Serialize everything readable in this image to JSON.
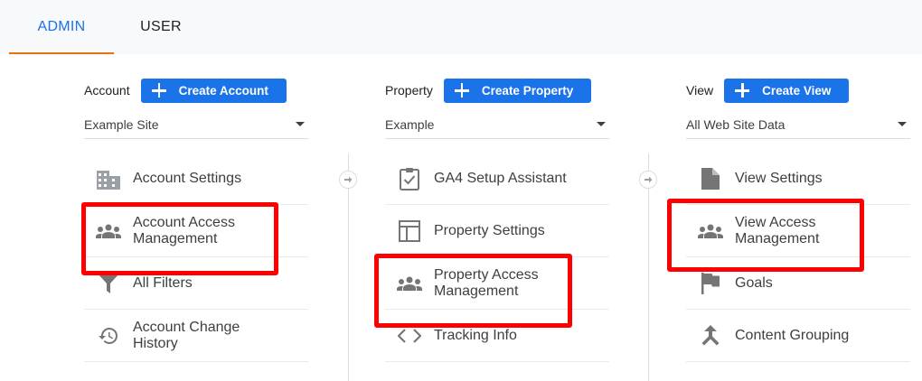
{
  "tabs": {
    "admin": "ADMIN",
    "user": "USER"
  },
  "accent_colors": {
    "primary": "#1a73e8",
    "tab_underline": "#e8710a",
    "highlight": "#ff0000"
  },
  "account": {
    "label": "Account",
    "create_button": "Create Account",
    "selected": "Example Site",
    "items": [
      {
        "label": "Account Settings",
        "icon": "building-icon"
      },
      {
        "label": "Account Access Management",
        "icon": "people-icon"
      },
      {
        "label": "All Filters",
        "icon": "filter-icon"
      },
      {
        "label": "Account Change History",
        "icon": "history-icon"
      }
    ]
  },
  "property": {
    "label": "Property",
    "create_button": "Create Property",
    "selected": "Example",
    "items": [
      {
        "label": "GA4 Setup Assistant",
        "icon": "clipboard-check-icon"
      },
      {
        "label": "Property Settings",
        "icon": "layout-icon"
      },
      {
        "label": "Property Access Management",
        "icon": "people-icon"
      },
      {
        "label": "Tracking Info",
        "icon": "code-icon"
      }
    ]
  },
  "view": {
    "label": "View",
    "create_button": "Create View",
    "selected": "All Web Site Data",
    "items": [
      {
        "label": "View Settings",
        "icon": "document-icon"
      },
      {
        "label": "View Access Management",
        "icon": "people-icon"
      },
      {
        "label": "Goals",
        "icon": "flag-icon"
      },
      {
        "label": "Content Grouping",
        "icon": "merge-icon"
      }
    ]
  }
}
